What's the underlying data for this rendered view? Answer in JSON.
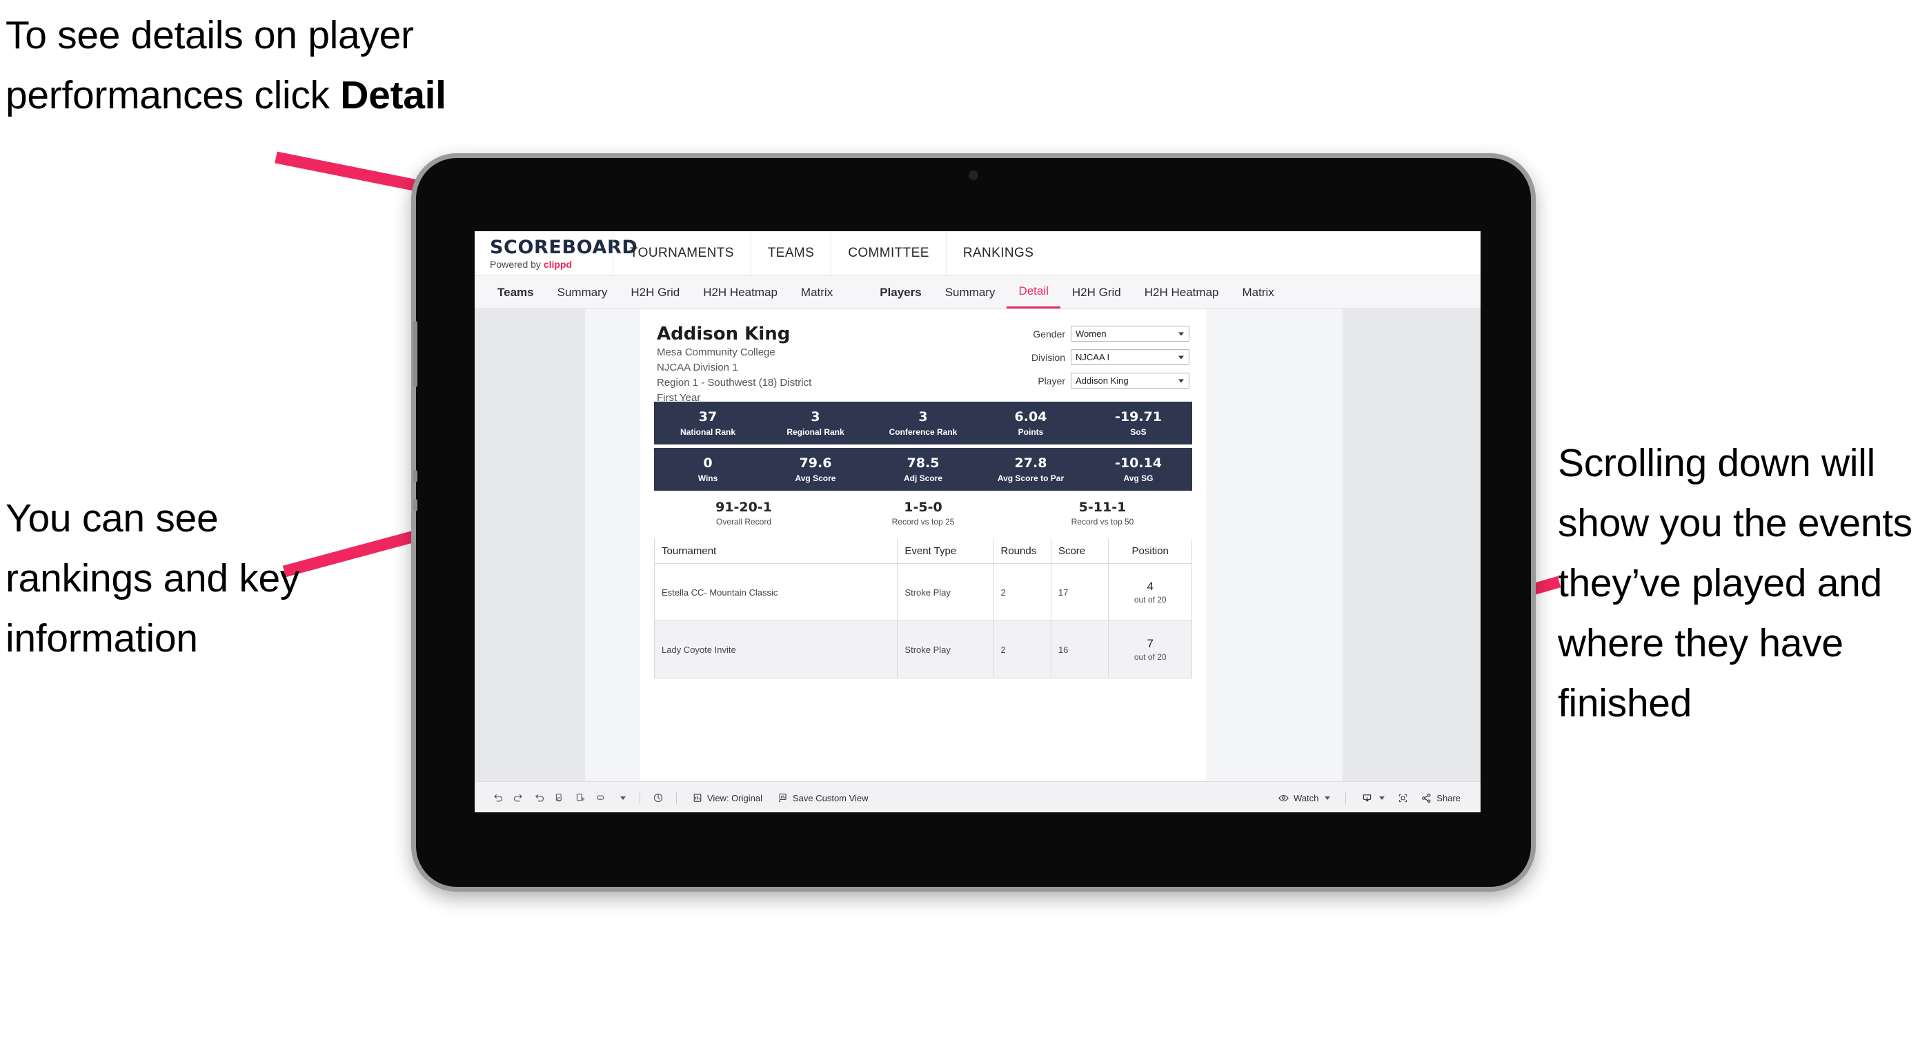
{
  "callouts": {
    "detail": "To see details on player performances click ",
    "detail_bold": "Detail",
    "rankings": "You can see rankings and key information",
    "scrolling": "Scrolling down will show you the events they’ve played and where they have finished"
  },
  "brand": {
    "title": "SCOREBOARD",
    "powered_prefix": "Powered by ",
    "powered_name": "clippd"
  },
  "topnav": {
    "items": [
      {
        "label": "TOURNAMENTS"
      },
      {
        "label": "TEAMS"
      },
      {
        "label": "COMMITTEE"
      },
      {
        "label": "RANKINGS"
      }
    ]
  },
  "subnav": {
    "teams_group": [
      {
        "label": "Teams",
        "head": true
      },
      {
        "label": "Summary",
        "head": false
      },
      {
        "label": "H2H Grid",
        "head": false
      },
      {
        "label": "H2H Heatmap",
        "head": false
      },
      {
        "label": "Matrix",
        "head": false
      }
    ],
    "players_group": [
      {
        "label": "Players",
        "head": true,
        "active": false
      },
      {
        "label": "Summary",
        "head": false,
        "active": false
      },
      {
        "label": "Detail",
        "head": false,
        "active": true
      },
      {
        "label": "H2H Grid",
        "head": false,
        "active": false
      },
      {
        "label": "H2H Heatmap",
        "head": false,
        "active": false
      },
      {
        "label": "Matrix",
        "head": false,
        "active": false
      }
    ]
  },
  "player": {
    "name": "Addison King",
    "school": "Mesa Community College",
    "division": "NJCAA Division 1",
    "region": "Region 1 - Southwest (18) District",
    "year": "First Year"
  },
  "filters": [
    {
      "label": "Gender",
      "value": "Women"
    },
    {
      "label": "Division",
      "value": "NJCAA I"
    },
    {
      "label": "Player",
      "value": "Addison King"
    }
  ],
  "stats_row_1": [
    {
      "value": "37",
      "label": "National Rank"
    },
    {
      "value": "3",
      "label": "Regional Rank"
    },
    {
      "value": "3",
      "label": "Conference Rank"
    },
    {
      "value": "6.04",
      "label": "Points"
    },
    {
      "value": "-19.71",
      "label": "SoS"
    }
  ],
  "stats_row_2": [
    {
      "value": "0",
      "label": "Wins"
    },
    {
      "value": "79.6",
      "label": "Avg Score"
    },
    {
      "value": "78.5",
      "label": "Adj Score"
    },
    {
      "value": "27.8",
      "label": "Avg Score to Par"
    },
    {
      "value": "-10.14",
      "label": "Avg SG"
    }
  ],
  "records": [
    {
      "value": "91-20-1",
      "label": "Overall Record"
    },
    {
      "value": "1-5-0",
      "label": "Record vs top 25"
    },
    {
      "value": "5-11-1",
      "label": "Record vs top 50"
    }
  ],
  "events_table": {
    "columns": [
      "Tournament",
      "Event Type",
      "Rounds",
      "Score",
      "Position"
    ],
    "rows": [
      {
        "tournament": "Estella CC- Mountain Classic",
        "event_type": "Stroke Play",
        "rounds": "2",
        "score": "17",
        "position": "4",
        "position_outof": "out of 20"
      },
      {
        "tournament": "Lady Coyote Invite",
        "event_type": "Stroke Play",
        "rounds": "2",
        "score": "16",
        "position": "7",
        "position_outof": "out of 20"
      }
    ]
  },
  "toolbar": {
    "view_original": "View: Original",
    "save_custom_view": "Save Custom View",
    "watch": "Watch",
    "share": "Share"
  },
  "colors": {
    "accent": "#f0275e",
    "stat_bar": "#2e3650",
    "canvas": "#e7e8ea"
  }
}
